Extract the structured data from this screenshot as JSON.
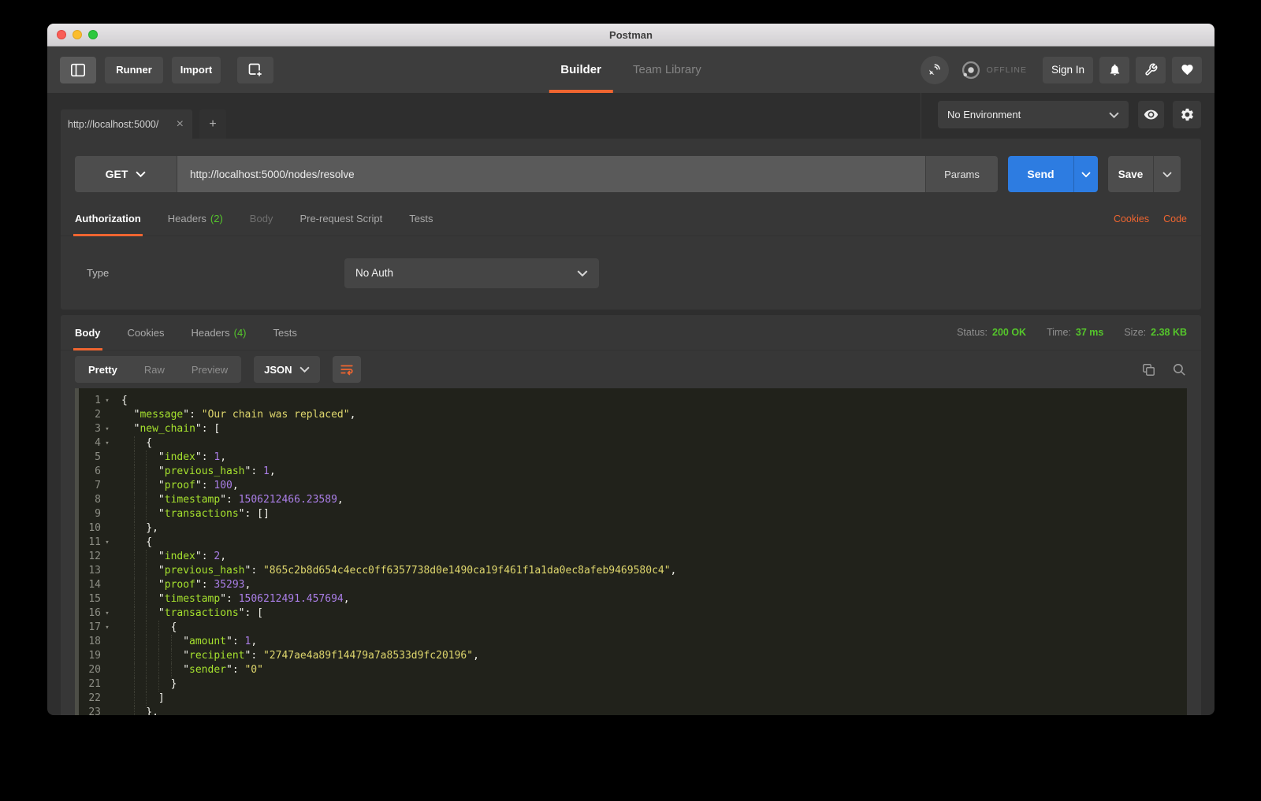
{
  "titlebar": {
    "title": "Postman"
  },
  "toolbar": {
    "runner_label": "Runner",
    "import_label": "Import",
    "builder_tab": "Builder",
    "team_library_tab": "Team Library",
    "offline_label": "OFFLINE",
    "sign_in_label": "Sign In"
  },
  "environment_bar": {
    "selected_environment": "No Environment"
  },
  "tab_strip": {
    "active_tab_title": "http://localhost:5000/",
    "close_glyph": "×",
    "new_tab_glyph": "+"
  },
  "request": {
    "method": "GET",
    "url": "http://localhost:5000/nodes/resolve",
    "params_label": "Params",
    "send_label": "Send",
    "save_label": "Save",
    "tabs": {
      "authorization": "Authorization",
      "headers": "Headers",
      "headers_count": "(2)",
      "body": "Body",
      "prerequest": "Pre-request Script",
      "tests": "Tests"
    },
    "links": {
      "cookies": "Cookies",
      "code": "Code"
    },
    "auth": {
      "type_label": "Type",
      "type_value": "No Auth"
    }
  },
  "response": {
    "tabs": {
      "body": "Body",
      "cookies": "Cookies",
      "headers": "Headers",
      "headers_count": "(4)",
      "tests": "Tests"
    },
    "meta": {
      "status_label": "Status:",
      "status_value": "200 OK",
      "time_label": "Time:",
      "time_value": "37 ms",
      "size_label": "Size:",
      "size_value": "2.38 KB"
    },
    "modes": {
      "pretty": "Pretty",
      "raw": "Raw",
      "preview": "Preview"
    },
    "language": "JSON",
    "code": {
      "fold_glyph": "▾",
      "lines": [
        {
          "num": 1,
          "fold": true,
          "ind": 0,
          "t": [
            [
              "p",
              "{"
            ]
          ]
        },
        {
          "num": 2,
          "fold": false,
          "ind": 1,
          "t": [
            [
              "q",
              "\""
            ],
            [
              "k",
              "message"
            ],
            [
              "q",
              "\""
            ],
            [
              "p",
              ": "
            ],
            [
              "s",
              "\"Our chain was replaced\""
            ],
            [
              "p",
              ","
            ]
          ]
        },
        {
          "num": 3,
          "fold": true,
          "ind": 1,
          "t": [
            [
              "q",
              "\""
            ],
            [
              "k",
              "new_chain"
            ],
            [
              "q",
              "\""
            ],
            [
              "p",
              ": ["
            ]
          ]
        },
        {
          "num": 4,
          "fold": true,
          "ind": 2,
          "t": [
            [
              "p",
              "{"
            ]
          ]
        },
        {
          "num": 5,
          "fold": false,
          "ind": 3,
          "t": [
            [
              "q",
              "\""
            ],
            [
              "k",
              "index"
            ],
            [
              "q",
              "\""
            ],
            [
              "p",
              ": "
            ],
            [
              "n",
              "1"
            ],
            [
              "p",
              ","
            ]
          ]
        },
        {
          "num": 6,
          "fold": false,
          "ind": 3,
          "t": [
            [
              "q",
              "\""
            ],
            [
              "k",
              "previous_hash"
            ],
            [
              "q",
              "\""
            ],
            [
              "p",
              ": "
            ],
            [
              "n",
              "1"
            ],
            [
              "p",
              ","
            ]
          ]
        },
        {
          "num": 7,
          "fold": false,
          "ind": 3,
          "t": [
            [
              "q",
              "\""
            ],
            [
              "k",
              "proof"
            ],
            [
              "q",
              "\""
            ],
            [
              "p",
              ": "
            ],
            [
              "n",
              "100"
            ],
            [
              "p",
              ","
            ]
          ]
        },
        {
          "num": 8,
          "fold": false,
          "ind": 3,
          "t": [
            [
              "q",
              "\""
            ],
            [
              "k",
              "timestamp"
            ],
            [
              "q",
              "\""
            ],
            [
              "p",
              ": "
            ],
            [
              "n",
              "1506212466.23589"
            ],
            [
              "p",
              ","
            ]
          ]
        },
        {
          "num": 9,
          "fold": false,
          "ind": 3,
          "t": [
            [
              "q",
              "\""
            ],
            [
              "k",
              "transactions"
            ],
            [
              "q",
              "\""
            ],
            [
              "p",
              ": []"
            ]
          ]
        },
        {
          "num": 10,
          "fold": false,
          "ind": 2,
          "t": [
            [
              "p",
              "},"
            ]
          ]
        },
        {
          "num": 11,
          "fold": true,
          "ind": 2,
          "t": [
            [
              "p",
              "{"
            ]
          ]
        },
        {
          "num": 12,
          "fold": false,
          "ind": 3,
          "t": [
            [
              "q",
              "\""
            ],
            [
              "k",
              "index"
            ],
            [
              "q",
              "\""
            ],
            [
              "p",
              ": "
            ],
            [
              "n",
              "2"
            ],
            [
              "p",
              ","
            ]
          ]
        },
        {
          "num": 13,
          "fold": false,
          "ind": 3,
          "t": [
            [
              "q",
              "\""
            ],
            [
              "k",
              "previous_hash"
            ],
            [
              "q",
              "\""
            ],
            [
              "p",
              ": "
            ],
            [
              "s",
              "\"865c2b8d654c4ecc0ff6357738d0e1490ca19f461f1a1da0ec8afeb9469580c4\""
            ],
            [
              "p",
              ","
            ]
          ]
        },
        {
          "num": 14,
          "fold": false,
          "ind": 3,
          "t": [
            [
              "q",
              "\""
            ],
            [
              "k",
              "proof"
            ],
            [
              "q",
              "\""
            ],
            [
              "p",
              ": "
            ],
            [
              "n",
              "35293"
            ],
            [
              "p",
              ","
            ]
          ]
        },
        {
          "num": 15,
          "fold": false,
          "ind": 3,
          "t": [
            [
              "q",
              "\""
            ],
            [
              "k",
              "timestamp"
            ],
            [
              "q",
              "\""
            ],
            [
              "p",
              ": "
            ],
            [
              "n",
              "1506212491.457694"
            ],
            [
              "p",
              ","
            ]
          ]
        },
        {
          "num": 16,
          "fold": true,
          "ind": 3,
          "t": [
            [
              "q",
              "\""
            ],
            [
              "k",
              "transactions"
            ],
            [
              "q",
              "\""
            ],
            [
              "p",
              ": ["
            ]
          ]
        },
        {
          "num": 17,
          "fold": true,
          "ind": 4,
          "t": [
            [
              "p",
              "{"
            ]
          ]
        },
        {
          "num": 18,
          "fold": false,
          "ind": 5,
          "t": [
            [
              "q",
              "\""
            ],
            [
              "k",
              "amount"
            ],
            [
              "q",
              "\""
            ],
            [
              "p",
              ": "
            ],
            [
              "n",
              "1"
            ],
            [
              "p",
              ","
            ]
          ]
        },
        {
          "num": 19,
          "fold": false,
          "ind": 5,
          "t": [
            [
              "q",
              "\""
            ],
            [
              "k",
              "recipient"
            ],
            [
              "q",
              "\""
            ],
            [
              "p",
              ": "
            ],
            [
              "s",
              "\"2747ae4a89f14479a7a8533d9fc20196\""
            ],
            [
              "p",
              ","
            ]
          ]
        },
        {
          "num": 20,
          "fold": false,
          "ind": 5,
          "t": [
            [
              "q",
              "\""
            ],
            [
              "k",
              "sender"
            ],
            [
              "q",
              "\""
            ],
            [
              "p",
              ": "
            ],
            [
              "s",
              "\"0\""
            ]
          ]
        },
        {
          "num": 21,
          "fold": false,
          "ind": 4,
          "t": [
            [
              "p",
              "}"
            ]
          ]
        },
        {
          "num": 22,
          "fold": false,
          "ind": 3,
          "t": [
            [
              "p",
              "]"
            ]
          ]
        },
        {
          "num": 23,
          "fold": false,
          "ind": 2,
          "t": [
            [
              "p",
              "},"
            ]
          ]
        }
      ]
    }
  },
  "colors": {
    "accent_orange": "#ef6530",
    "send_blue": "#2d7ce1",
    "status_green": "#55c62b",
    "code_key": "#a6e22e",
    "code_string": "#dfd76d",
    "code_number": "#ab7fe8",
    "code_background": "#21221b"
  }
}
